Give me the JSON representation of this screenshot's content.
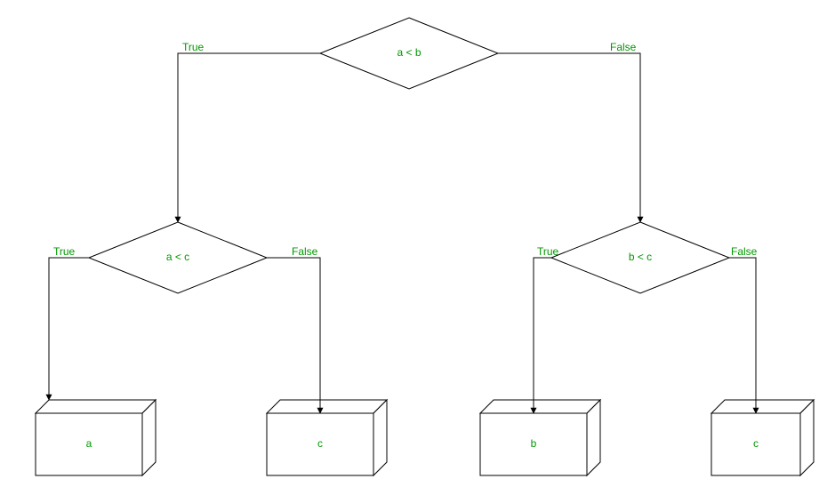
{
  "nodes": {
    "root": {
      "type": "decision",
      "label": "a < b"
    },
    "left": {
      "type": "decision",
      "label": "a < c"
    },
    "right": {
      "type": "decision",
      "label": "b < c"
    },
    "out_a": {
      "type": "output",
      "label": "a"
    },
    "out_c1": {
      "type": "output",
      "label": "c"
    },
    "out_b": {
      "type": "output",
      "label": "b"
    },
    "out_c2": {
      "type": "output",
      "label": "c"
    }
  },
  "edges": {
    "root_true": {
      "label": "True"
    },
    "root_false": {
      "label": "False"
    },
    "left_true": {
      "label": "True"
    },
    "left_false": {
      "label": "False"
    },
    "right_true": {
      "label": "True"
    },
    "right_false": {
      "label": "False"
    }
  }
}
